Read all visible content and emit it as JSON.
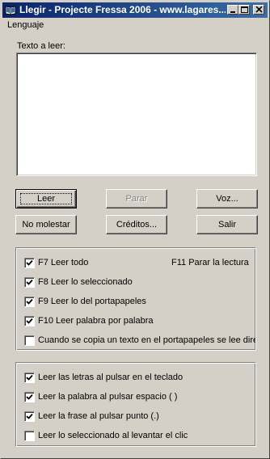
{
  "window": {
    "title": "Llegir - Projecte Fressa 2006 - www.lagares...",
    "buttons": {
      "minimize_icon": "minimize-icon",
      "maximize_icon": "maximize-icon",
      "close_icon": "close-icon"
    }
  },
  "menubar": {
    "items": [
      {
        "label": "Lenguaje"
      }
    ]
  },
  "text_area": {
    "label": "Texto a leer:",
    "value": ""
  },
  "buttons": {
    "leer": "Leer",
    "parar": "Parar",
    "voz": "Voz...",
    "no_molestar": "No molestar",
    "creditos": "Créditos...",
    "salir": "Salir"
  },
  "group1": {
    "hint": "F11 Parar la lectura",
    "options": [
      {
        "label": "F7 Leer todo",
        "checked": true
      },
      {
        "label": "F8 Leer lo seleccionado",
        "checked": true
      },
      {
        "label": "F9 Leer lo del portapapeles",
        "checked": true
      },
      {
        "label": "F10 Leer palabra por palabra",
        "checked": true
      },
      {
        "label": "Cuando se copia un texto en el portapapeles se lee direc",
        "checked": false
      }
    ]
  },
  "group2": {
    "options": [
      {
        "label": "Leer las letras al pulsar en el teclado",
        "checked": true
      },
      {
        "label": "Leer la palabra al pulsar espacio ( )",
        "checked": true
      },
      {
        "label": "Leer la frase al pulsar punto (.)",
        "checked": true
      },
      {
        "label": "Leer lo seleccionado al levantar el clic",
        "checked": false
      }
    ]
  }
}
